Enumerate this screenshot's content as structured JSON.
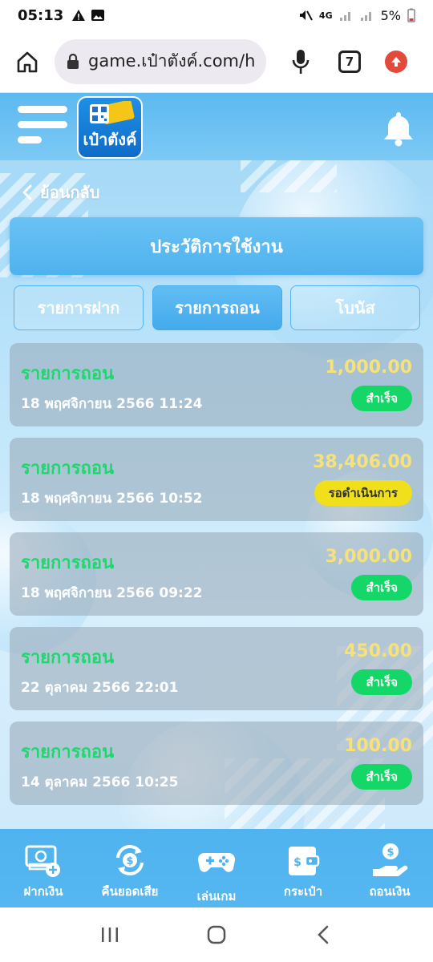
{
  "status_bar": {
    "time": "05:13",
    "battery": "5%",
    "network": "4G"
  },
  "browser": {
    "url": "game.เป๋าตังค์.com/h",
    "tab_count": "7"
  },
  "app": {
    "logo_text": "เป๋าตังค์",
    "back_label": "ย้อนกลับ",
    "page_title": "ประวัติการใช้งาน",
    "tabs": [
      {
        "label": "รายการฝาก",
        "active": false
      },
      {
        "label": "รายการถอน",
        "active": true
      },
      {
        "label": "โบนัส",
        "active": false
      }
    ],
    "transactions": [
      {
        "type": "รายการถอน",
        "date": "18 พฤศจิกายน 2566 11:24",
        "amount": "1,000.00",
        "status": "สำเร็จ",
        "status_kind": "success"
      },
      {
        "type": "รายการถอน",
        "date": "18 พฤศจิกายน 2566 10:52",
        "amount": "38,406.00",
        "status": "รอดำเนินการ",
        "status_kind": "pending"
      },
      {
        "type": "รายการถอน",
        "date": "18 พฤศจิกายน 2566 09:22",
        "amount": "3,000.00",
        "status": "สำเร็จ",
        "status_kind": "success"
      },
      {
        "type": "รายการถอน",
        "date": "22 ตุลาคม 2566 22:01",
        "amount": "450.00",
        "status": "สำเร็จ",
        "status_kind": "success"
      },
      {
        "type": "รายการถอน",
        "date": "14 ตุลาคม 2566 10:25",
        "amount": "100.00",
        "status": "สำเร็จ",
        "status_kind": "success"
      }
    ]
  },
  "bottom_nav": [
    {
      "label": "ฝากเงิน",
      "icon": "deposit-money-icon"
    },
    {
      "label": "คืนยอดเสีย",
      "icon": "cashback-icon"
    },
    {
      "label": "เล่นเกม",
      "icon": "gamepad-icon"
    },
    {
      "label": "กระเป๋า",
      "icon": "wallet-icon"
    },
    {
      "label": "ถอนเงิน",
      "icon": "withdraw-money-icon"
    }
  ],
  "colors": {
    "success": "#14d768",
    "pending": "#f0e01b",
    "type_text": "#1fd66f",
    "amount_text": "#f6e27a",
    "header_blue": "#5cb9f0"
  }
}
